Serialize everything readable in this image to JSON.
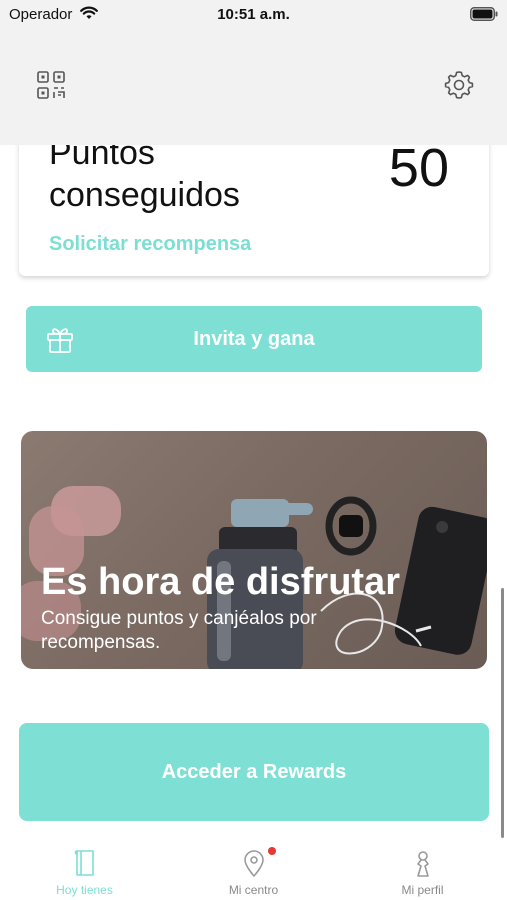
{
  "status_bar": {
    "carrier": "Operador",
    "time": "10:51 a.m."
  },
  "top_nav": {
    "left_icon": "qr-code-icon",
    "right_icon": "gear-icon"
  },
  "points_card": {
    "label": "Puntos conseguidos",
    "value": "50",
    "link_label": "Solicitar recompensa"
  },
  "invite": {
    "icon": "gift-icon",
    "label": "Invita y gana"
  },
  "promo": {
    "title": "Es hora de disfrutar",
    "subtitle": "Consigue puntos y canjéalos por recompensas."
  },
  "rewards_button": {
    "label": "Acceder a Rewards"
  },
  "tab_bar": {
    "tabs": [
      {
        "label": "Hoy tienes",
        "icon": "book-icon",
        "active": true
      },
      {
        "label": "Mi centro",
        "icon": "location-pin-icon",
        "badge": true
      },
      {
        "label": "Mi perfil",
        "icon": "person-icon"
      }
    ]
  },
  "colors": {
    "accent": "#7ee0d4",
    "accent_text": "#7ddfd3",
    "badge": "#e53935",
    "nav_background": "#f2f2f2"
  }
}
